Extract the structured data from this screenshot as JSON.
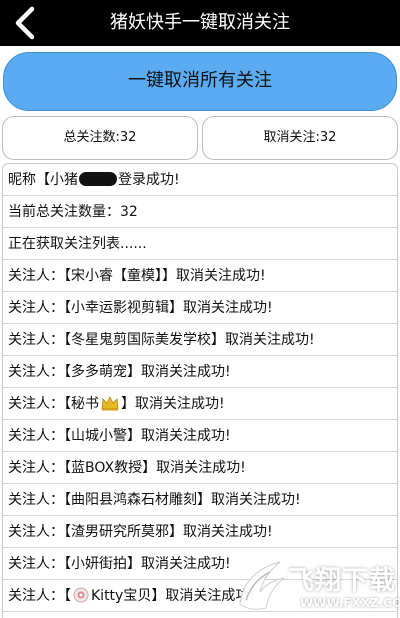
{
  "topbar": {
    "title": "猪妖快手一键取消关注"
  },
  "main_button": {
    "label": "一键取消所有关注"
  },
  "stats": {
    "total_follow": "总关注数:32",
    "cancel_follow": "取消关注:32"
  },
  "log": {
    "login_prefix": "昵称【小猪",
    "login_suffix": "登录成功!",
    "current_count": "当前总关注数量：32",
    "fetching": "正在获取关注列表......",
    "entries": [
      {
        "prefix": "关注人：",
        "name": "【宋小睿【童模】】",
        "result": "取消关注成功!"
      },
      {
        "prefix": "关注人：",
        "name": "【小幸运影视剪辑】",
        "result": "取消关注成功!"
      },
      {
        "prefix": "关注人：",
        "name": "【冬星鬼剪国际美发学校】",
        "result": "取消关注成功!"
      },
      {
        "prefix": "关注人：",
        "name": "【多多萌宠】",
        "result": "取消关注成功!"
      },
      {
        "prefix": "关注人：",
        "name_before_icon": "【秘书",
        "name_after_icon": "】",
        "result": "取消关注成功!"
      },
      {
        "prefix": "关注人：",
        "name": "【山城小警】",
        "result": "取消关注成功!"
      },
      {
        "prefix": "关注人：",
        "name": "【蓝BOX教授】",
        "result": "取消关注成功!"
      },
      {
        "prefix": "关注人：",
        "name": "【曲阳县鸿森石材雕刻】",
        "result": "取消关注成功!"
      },
      {
        "prefix": "关注人：",
        "name": "【渣男研究所莫邪】",
        "result": "取消关注成功!"
      },
      {
        "prefix": "关注人：",
        "name": "【小妍街拍】",
        "result": "取消关注成功!"
      },
      {
        "prefix": "关注人：",
        "name_before_icon": "【",
        "name_after_icon": "Kitty宝贝】",
        "result": "取消关注成功!"
      }
    ]
  },
  "watermark": {
    "title": "飞翔下载",
    "url": "WWW.FXXZ.COM"
  },
  "colors": {
    "topbar_bg": "#000000",
    "button_blue": "#5aabf2",
    "border_gray": "#bdbdbd"
  }
}
